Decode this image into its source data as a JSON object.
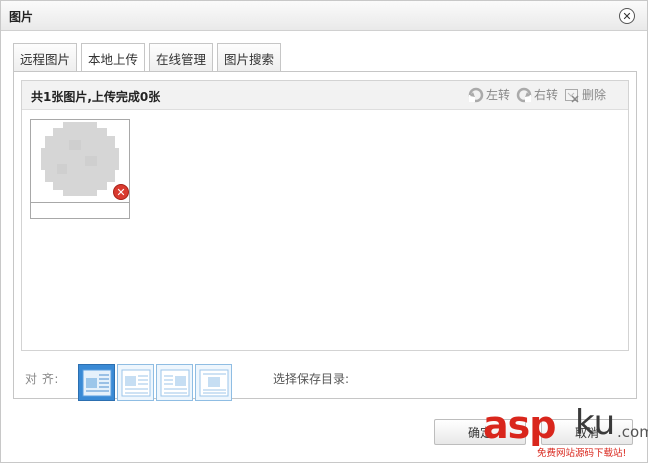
{
  "dialog": {
    "title": "图片"
  },
  "tabs": [
    {
      "label": "远程图片"
    },
    {
      "label": "本地上传"
    },
    {
      "label": "在线管理"
    },
    {
      "label": "图片搜索"
    }
  ],
  "active_tab": "本地上传",
  "upload": {
    "status": "共1张图片,上传完成0张",
    "actions": {
      "rotate_left": "左转",
      "rotate_right": "右转",
      "delete": "删除"
    }
  },
  "align": {
    "label": "对 齐:",
    "selected_index": 0,
    "options_count": 4
  },
  "save_dir_label": "选择保存目录:",
  "buttons": {
    "confirm": "确定",
    "cancel": "取消"
  },
  "watermark": {
    "brand_red": "asp",
    "brand_dark": "ku",
    "suffix": ".com",
    "tagline": "免费网站源码下载站!"
  },
  "colors": {
    "accent": "#3a8ad5",
    "remove": "#d93a2f",
    "brand_red": "#d9261c"
  }
}
